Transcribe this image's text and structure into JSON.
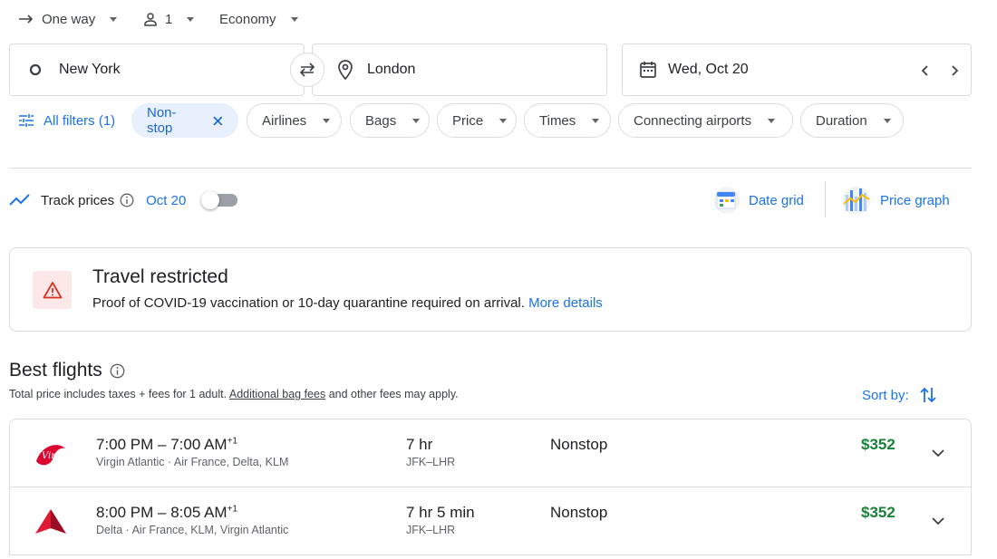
{
  "search": {
    "trip_type": "One way",
    "passengers": "1",
    "cabin_class": "Economy",
    "origin": "New York",
    "destination": "London",
    "date": "Wed, Oct 20"
  },
  "filters": {
    "all_filters_label": "All filters (1)",
    "active_chip": "Non-stop",
    "chips": [
      "Airlines",
      "Bags",
      "Price",
      "Times",
      "Connecting airports",
      "Duration"
    ]
  },
  "track": {
    "label": "Track prices",
    "date": "Oct 20",
    "toggle_on": false,
    "date_grid_label": "Date grid",
    "price_graph_label": "Price graph"
  },
  "alert": {
    "title": "Travel restricted",
    "message": "Proof of COVID-19 vaccination or 10-day quarantine required on arrival.",
    "link": "More details"
  },
  "best_flights": {
    "title": "Best flights",
    "subtitle_pre": "Total price includes taxes + fees for 1 adult.",
    "subtitle_link": "Additional bag fees",
    "subtitle_post": "and other fees may apply.",
    "sort_label": "Sort by:",
    "flights": [
      {
        "times": "7:00 PM – 7:00 AM",
        "day_offset": "+1",
        "airlines": "Virgin Atlantic · Air France, Delta, KLM",
        "duration": "7 hr",
        "route": "JFK–LHR",
        "stops": "Nonstop",
        "price": "$352",
        "logo": "virgin-atlantic-logo"
      },
      {
        "times": "8:00 PM – 8:05 AM",
        "day_offset": "+1",
        "airlines": "Delta · Air France, KLM, Virgin Atlantic",
        "duration": "7 hr 5 min",
        "route": "JFK–LHR",
        "stops": "Nonstop",
        "price": "$352",
        "logo": "delta-logo"
      }
    ]
  },
  "colors": {
    "accent": "#1a73e8",
    "price_green": "#188038",
    "alert_bg": "#fce8e6",
    "alert_red": "#d93025",
    "chip_active_bg": "#e8f0fe"
  }
}
